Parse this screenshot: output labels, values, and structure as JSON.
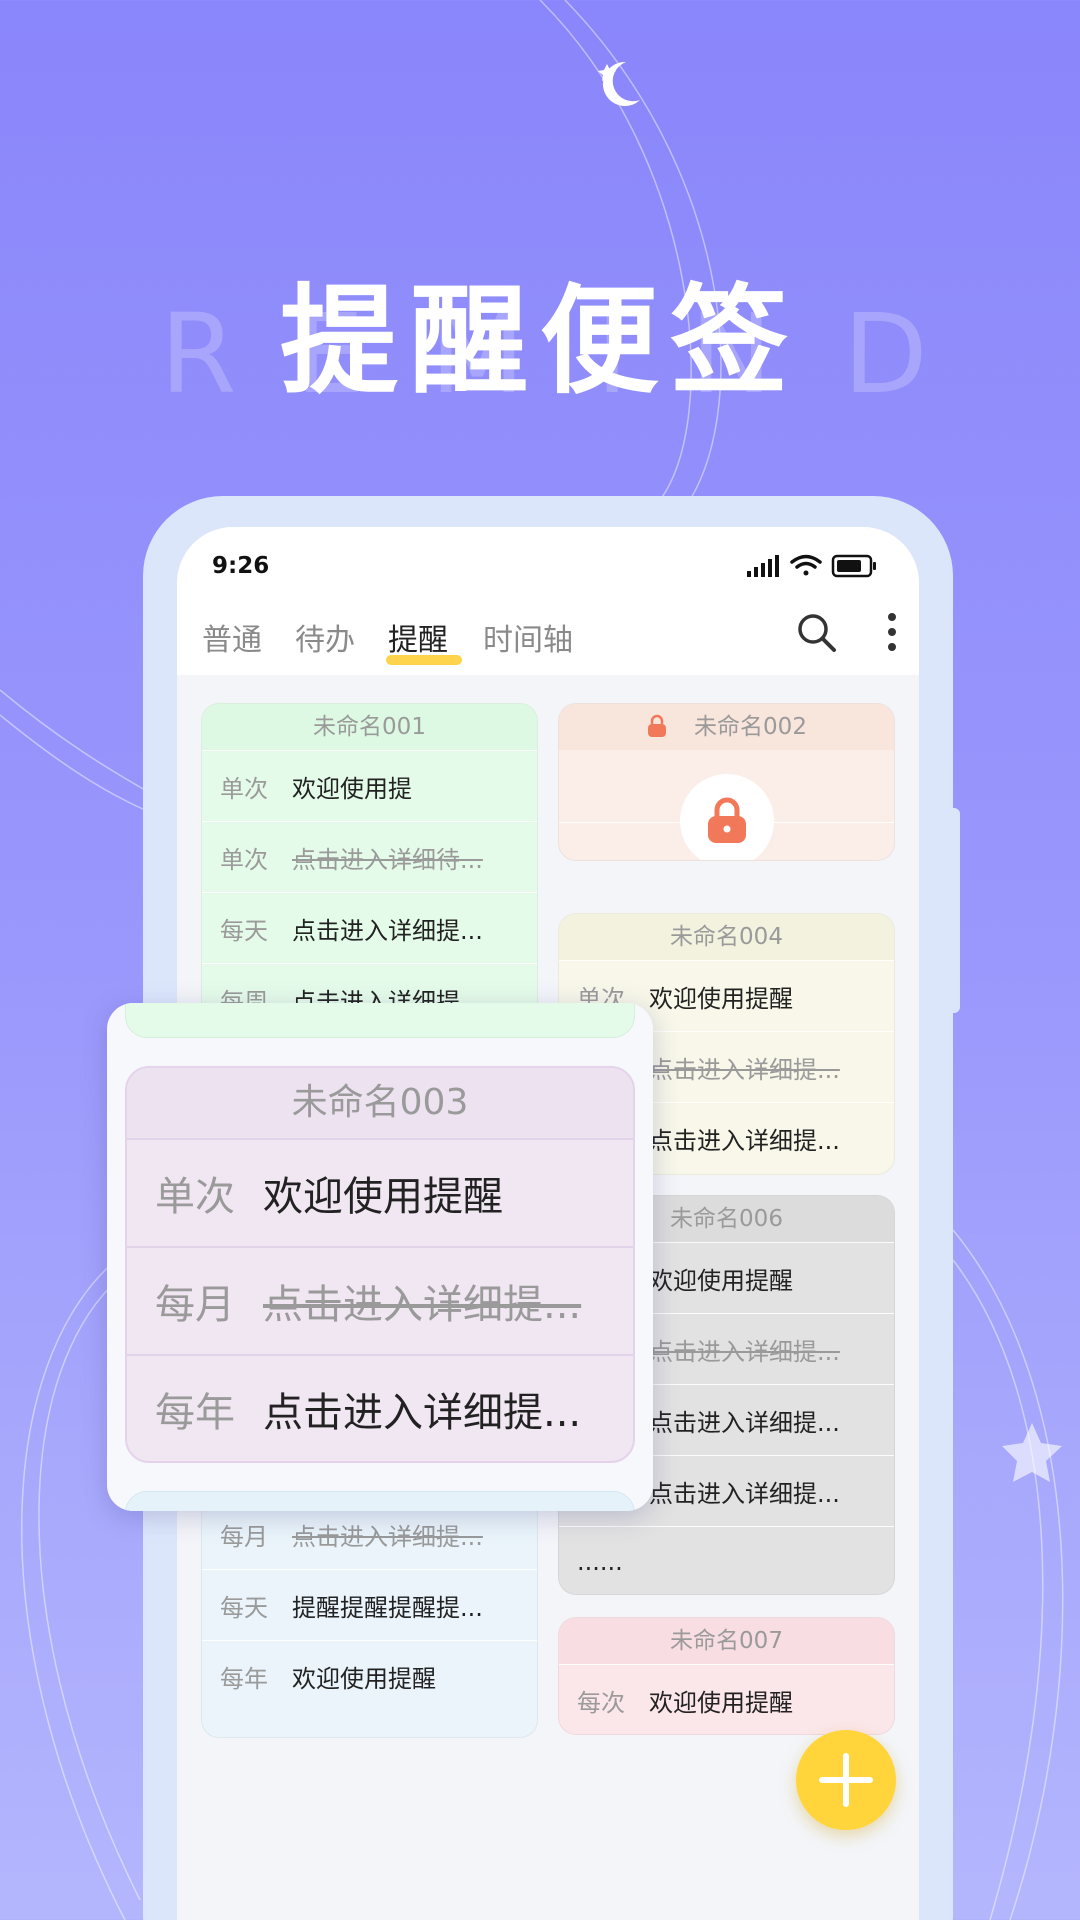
{
  "headline": "提醒便签",
  "bg_letters": [
    "R",
    "E",
    "M",
    "I",
    "N",
    "D"
  ],
  "status_bar": {
    "time": "9:26"
  },
  "tabs": [
    {
      "label": "普通",
      "active": false
    },
    {
      "label": "待办",
      "active": false
    },
    {
      "label": "提醒",
      "active": true
    },
    {
      "label": "时间轴",
      "active": false
    }
  ],
  "notes": {
    "n001": {
      "title": "未命名001",
      "rows": [
        {
          "freq": "单次",
          "text": "欢迎使用提"
        },
        {
          "freq": "单次",
          "text": "点击进入详细待..."
        },
        {
          "freq": "每天",
          "text": "点击进入详细提..."
        },
        {
          "freq": "每周",
          "text": "点击进入详细提..."
        }
      ]
    },
    "n002": {
      "title": "未命名002",
      "locked": true
    },
    "n004": {
      "title": "未命名004",
      "rows": [
        {
          "freq": "单次",
          "text": "欢迎使用提醒"
        },
        {
          "freq": "",
          "text": "点击进入详细提..."
        },
        {
          "freq": "",
          "text": "点击进入详细提..."
        }
      ]
    },
    "n006": {
      "title": "未命名006",
      "rows": [
        {
          "freq": "",
          "text": "欢迎使用提醒"
        },
        {
          "freq": "",
          "text": "点击进入详细提..."
        },
        {
          "freq": "",
          "text": "点击进入详细提..."
        },
        {
          "freq": "",
          "text": "点击进入详细提..."
        },
        {
          "freq": "",
          "text": "......"
        }
      ]
    },
    "n007": {
      "title": "未命名007",
      "rows": [
        {
          "freq": "每次",
          "text": "欢迎使用提醒"
        }
      ]
    },
    "n005": {
      "rows": [
        {
          "freq": "每月",
          "text": "点击进入详细提..."
        },
        {
          "freq": "每天",
          "text": "提醒提醒提醒提..."
        },
        {
          "freq": "每年",
          "text": "欢迎使用提醒"
        }
      ]
    }
  },
  "popup": {
    "title": "未命名003",
    "rows": [
      {
        "freq": "单次",
        "text": "欢迎使用提醒"
      },
      {
        "freq": "每月",
        "text": "点击进入详细提..."
      },
      {
        "freq": "每年",
        "text": "点击进入详细提..."
      }
    ]
  },
  "icons": {
    "search": "search-icon",
    "more": "more-vertical-icon",
    "lock": "lock-icon",
    "add": "plus-icon"
  },
  "colors": {
    "accent": "#ffd53b",
    "lock": "#f2785a",
    "background_top": "#8a86fb",
    "background_bottom": "#b4b6fd"
  }
}
